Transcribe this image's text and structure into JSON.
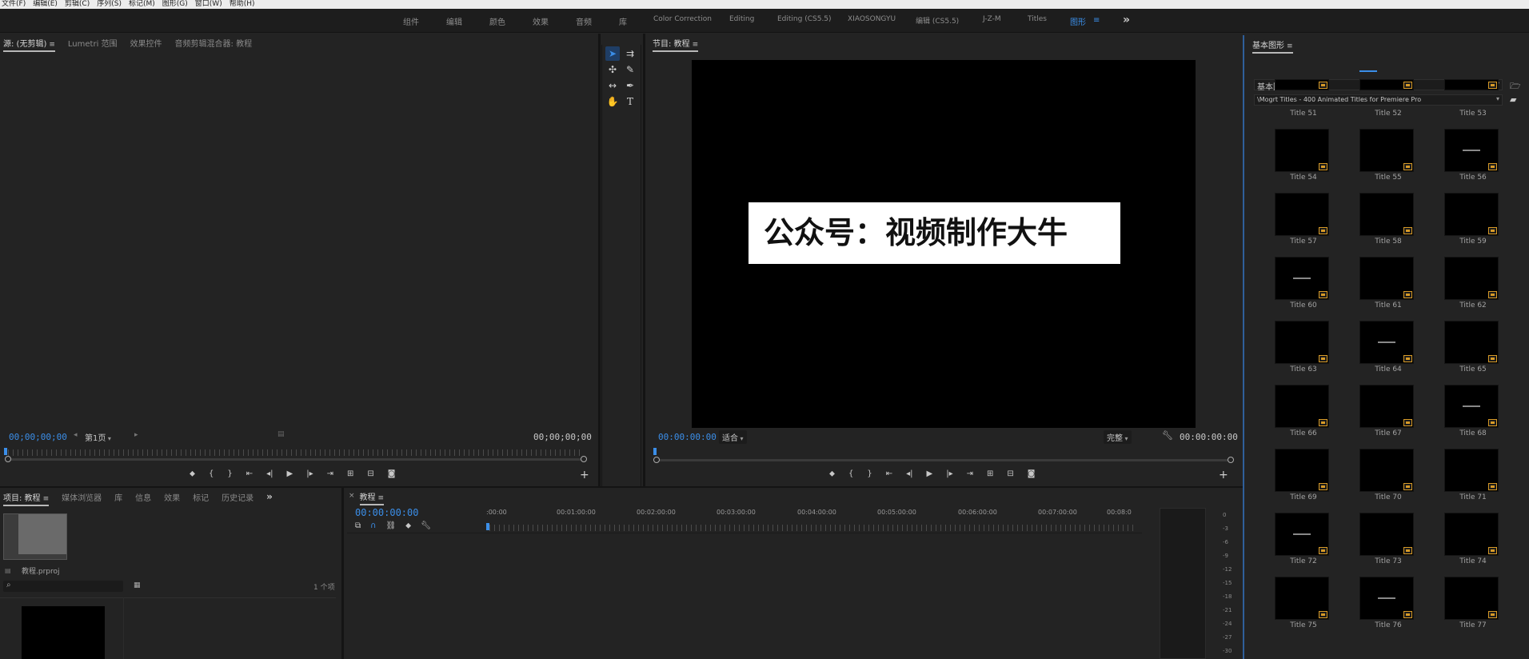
{
  "menu": [
    "文件(F)",
    "编辑(E)",
    "剪辑(C)",
    "序列(S)",
    "标记(M)",
    "图形(G)",
    "窗口(W)",
    "帮助(H)"
  ],
  "workspaces": [
    "组件",
    "编辑",
    "颜色",
    "效果",
    "音频",
    "库",
    "Color Correction",
    "Editing",
    "Editing (CS5.5)",
    "XIAOSONGYU",
    "编辑 (CS5.5)",
    "J-Z-M",
    "Titles",
    "图形"
  ],
  "workspace_active": "图形",
  "source_panel": {
    "tabs": [
      "源: (无剪辑)",
      "Lumetri 范围",
      "效果控件",
      "音频剪辑混合器: 教程"
    ],
    "timecode_in": "00;00;00;00",
    "page_select": "第1页",
    "timecode_out": "00;00;00;00"
  },
  "program_panel": {
    "tab": "节目: 教程",
    "title_text": "公众号：视频制作大牛",
    "timecode": "00:00:00:00",
    "fit": "适合",
    "quality": "完整",
    "timecode_end": "00:00:00:00"
  },
  "project_panel": {
    "tabs": [
      "项目: 教程",
      "媒体浏览器",
      "库",
      "信息",
      "效果",
      "标记",
      "历史记录"
    ],
    "file_name": "教程.prproj",
    "item_count": "1 个项"
  },
  "timeline": {
    "tab": "教程",
    "timecode": "00:00:00:00",
    "ruler_labels": [
      ":00:00",
      "00:01:00:00",
      "00:02:00:00",
      "00:03:00:00",
      "00:04:00:00",
      "00:05:00:00",
      "00:06:00:00",
      "00:07:00:00",
      "00:08:0"
    ]
  },
  "audio_meter": {
    "db_labels": [
      "0",
      "-3",
      "-6",
      "-9",
      "-12",
      "-15",
      "-18",
      "-21",
      "-24",
      "-27",
      "-30"
    ]
  },
  "essential_graphics": {
    "tab": "基本图形",
    "folder_select": "基本图形",
    "library_select": "\\Mogrt Titles - 400 Animated Titles for Premiere Pro",
    "titles": [
      "Title 51",
      "Title 52",
      "Title 53",
      "Title 54",
      "Title 55",
      "Title 56",
      "Title 57",
      "Title 58",
      "Title 59",
      "Title 60",
      "Title 61",
      "Title 62",
      "Title 63",
      "Title 64",
      "Title 65",
      "Title 66",
      "Title 67",
      "Title 68",
      "Title 69",
      "Title 70",
      "Title 71",
      "Title 72",
      "Title 73",
      "Title 74",
      "Title 75",
      "Title 76",
      "Title 77"
    ]
  },
  "colors": {
    "accent": "#3b8ee8",
    "badge": "#d79a27"
  }
}
